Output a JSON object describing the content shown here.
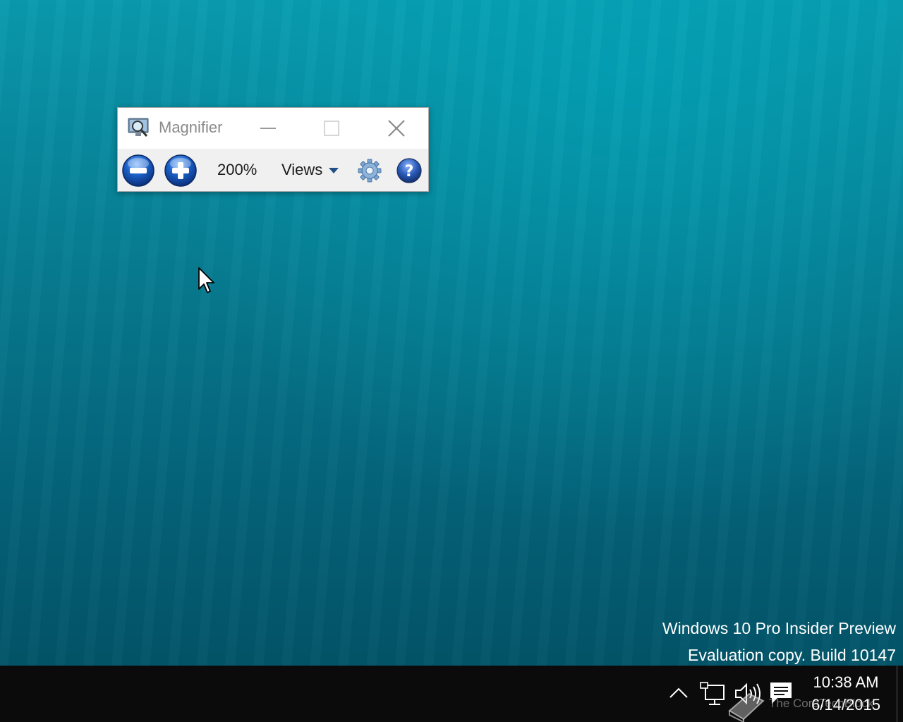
{
  "magnifier": {
    "title": "Magnifier",
    "zoom_level": "200%",
    "views_label": "Views",
    "icons": {
      "app": "magnifier-app-icon",
      "minimize": "minimize-icon",
      "maximize": "maximize-icon",
      "close": "close-icon",
      "zoom_out": "zoom-out-icon",
      "zoom_in": "zoom-in-icon",
      "views_caret": "caret-down-icon",
      "settings": "gear-icon",
      "help": "help-icon"
    }
  },
  "watermark": {
    "line1": "Windows 10 Pro Insider Preview",
    "line2": "Evaluation copy. Build 10147"
  },
  "taskbar": {
    "clock": {
      "time": "10:38 AM",
      "date": "6/14/2015"
    },
    "icons": [
      "chevron-up-icon",
      "network-icon",
      "volume-icon",
      "action-center-icon"
    ]
  },
  "logo_text": "The CoreTechBlock",
  "colors": {
    "desktop_accent": "#07788e",
    "taskbar": "#0b0b0b",
    "button_blue": "#1b5fc6"
  }
}
